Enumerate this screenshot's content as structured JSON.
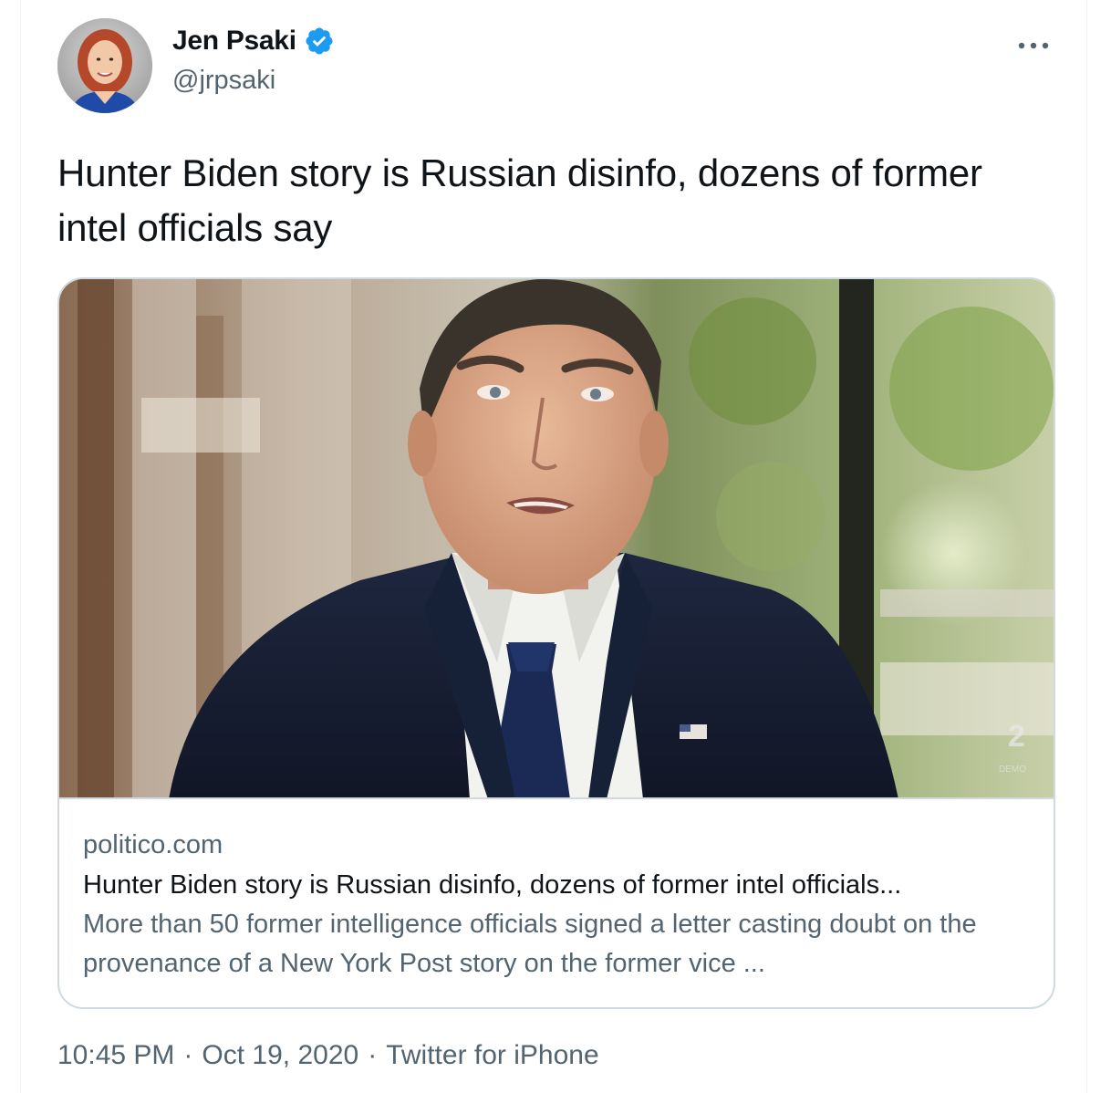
{
  "author": {
    "name": "Jen Psaki",
    "handle": "@jrpsaki",
    "verified": true
  },
  "more_icon": "more-horizontal-icon",
  "tweet": {
    "text": "Hunter Biden story is Russian disinfo, dozens of former intel officials say"
  },
  "card": {
    "domain": "politico.com",
    "title": "Hunter Biden story is Russian disinfo, dozens of former intel officials...",
    "description": "More than 50 former intelligence officials signed a letter casting doubt on the provenance of a New York Post story on the former vice ..."
  },
  "meta": {
    "time": "10:45 PM",
    "date": "Oct 19, 2020",
    "source": "Twitter for iPhone",
    "separator": "·"
  },
  "colors": {
    "text_primary": "#0f1419",
    "text_secondary": "#536471",
    "verified_blue": "#1d9bf0",
    "border": "#cfd9de"
  }
}
